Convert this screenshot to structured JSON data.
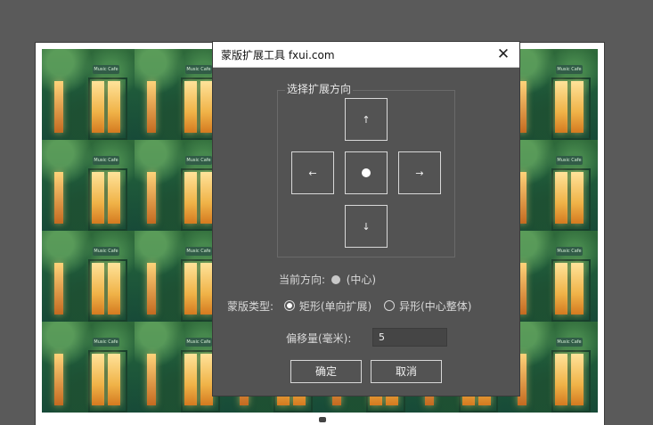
{
  "document": {
    "tile_sign_text": "Music Cafe"
  },
  "dialog": {
    "title": "蒙版扩展工具 fxui.com",
    "close_glyph": "✕",
    "direction_group": {
      "label": "选择扩展方向",
      "up": "↑",
      "left": "←",
      "right": "→",
      "down": "↓"
    },
    "current_direction": {
      "label": "当前方向:",
      "value": "(中心)"
    },
    "mask_type": {
      "label": "蒙版类型:",
      "options": [
        {
          "label": "矩形(单向扩展)",
          "selected": true
        },
        {
          "label": "异形(中心整体)",
          "selected": false
        }
      ]
    },
    "offset": {
      "label": "偏移量(毫米):",
      "value": "5"
    },
    "buttons": {
      "ok": "确定",
      "cancel": "取消"
    }
  },
  "colors": {
    "workspace_bg": "#5a5a5a",
    "dialog_bg": "#535353",
    "titlebar_bg": "#ffffff"
  }
}
